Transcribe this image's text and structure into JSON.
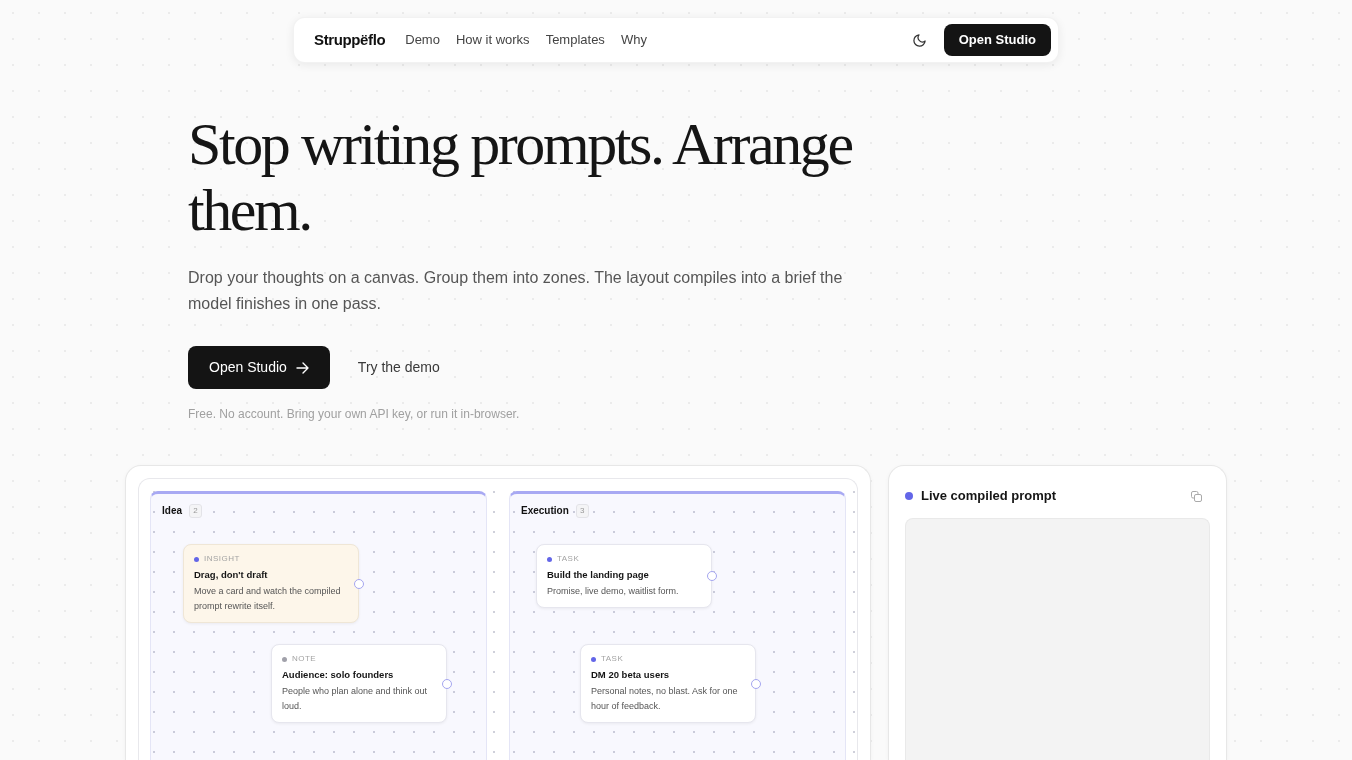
{
  "nav": {
    "logo": "Struppëflo",
    "links": [
      {
        "label": "Demo"
      },
      {
        "label": "How it works"
      },
      {
        "label": "Templates"
      },
      {
        "label": "Why"
      }
    ],
    "cta": "Open Studio"
  },
  "hero": {
    "title": "Stop writing prompts. Arrange them.",
    "subtitle": "Drop your thoughts on a canvas. Group them into zones. The layout compiles into a brief the model finishes in one pass.",
    "primary_button": "Open Studio",
    "secondary_button": "Try the demo",
    "note": "Free. No account. Bring your own API key, or run it in-browser."
  },
  "canvas": {
    "zones": [
      {
        "name": "Idea",
        "count": "2",
        "cards": [
          {
            "kind": "insight",
            "tag": "INSIGHT",
            "color": "#6366e8",
            "title": "Drag, don't draft",
            "body": "Move a card and watch the compiled prompt rewrite itself."
          },
          {
            "kind": "note",
            "tag": "NOTE",
            "color": "#a1a1aa",
            "title": "Audience: solo founders",
            "body": "People who plan alone and think out loud."
          }
        ]
      },
      {
        "name": "Execution",
        "count": "3",
        "cards": [
          {
            "kind": "task",
            "tag": "TASK",
            "color": "#6366e8",
            "title": "Build the landing page",
            "body": "Promise, live demo, waitlist form."
          },
          {
            "kind": "task",
            "tag": "TASK",
            "color": "#6366e8",
            "title": "DM 20 beta users",
            "body": "Personal notes, no blast. Ask for one hour of feedback."
          }
        ]
      }
    ]
  },
  "compiled_prompt": {
    "title": "Live compiled prompt"
  }
}
